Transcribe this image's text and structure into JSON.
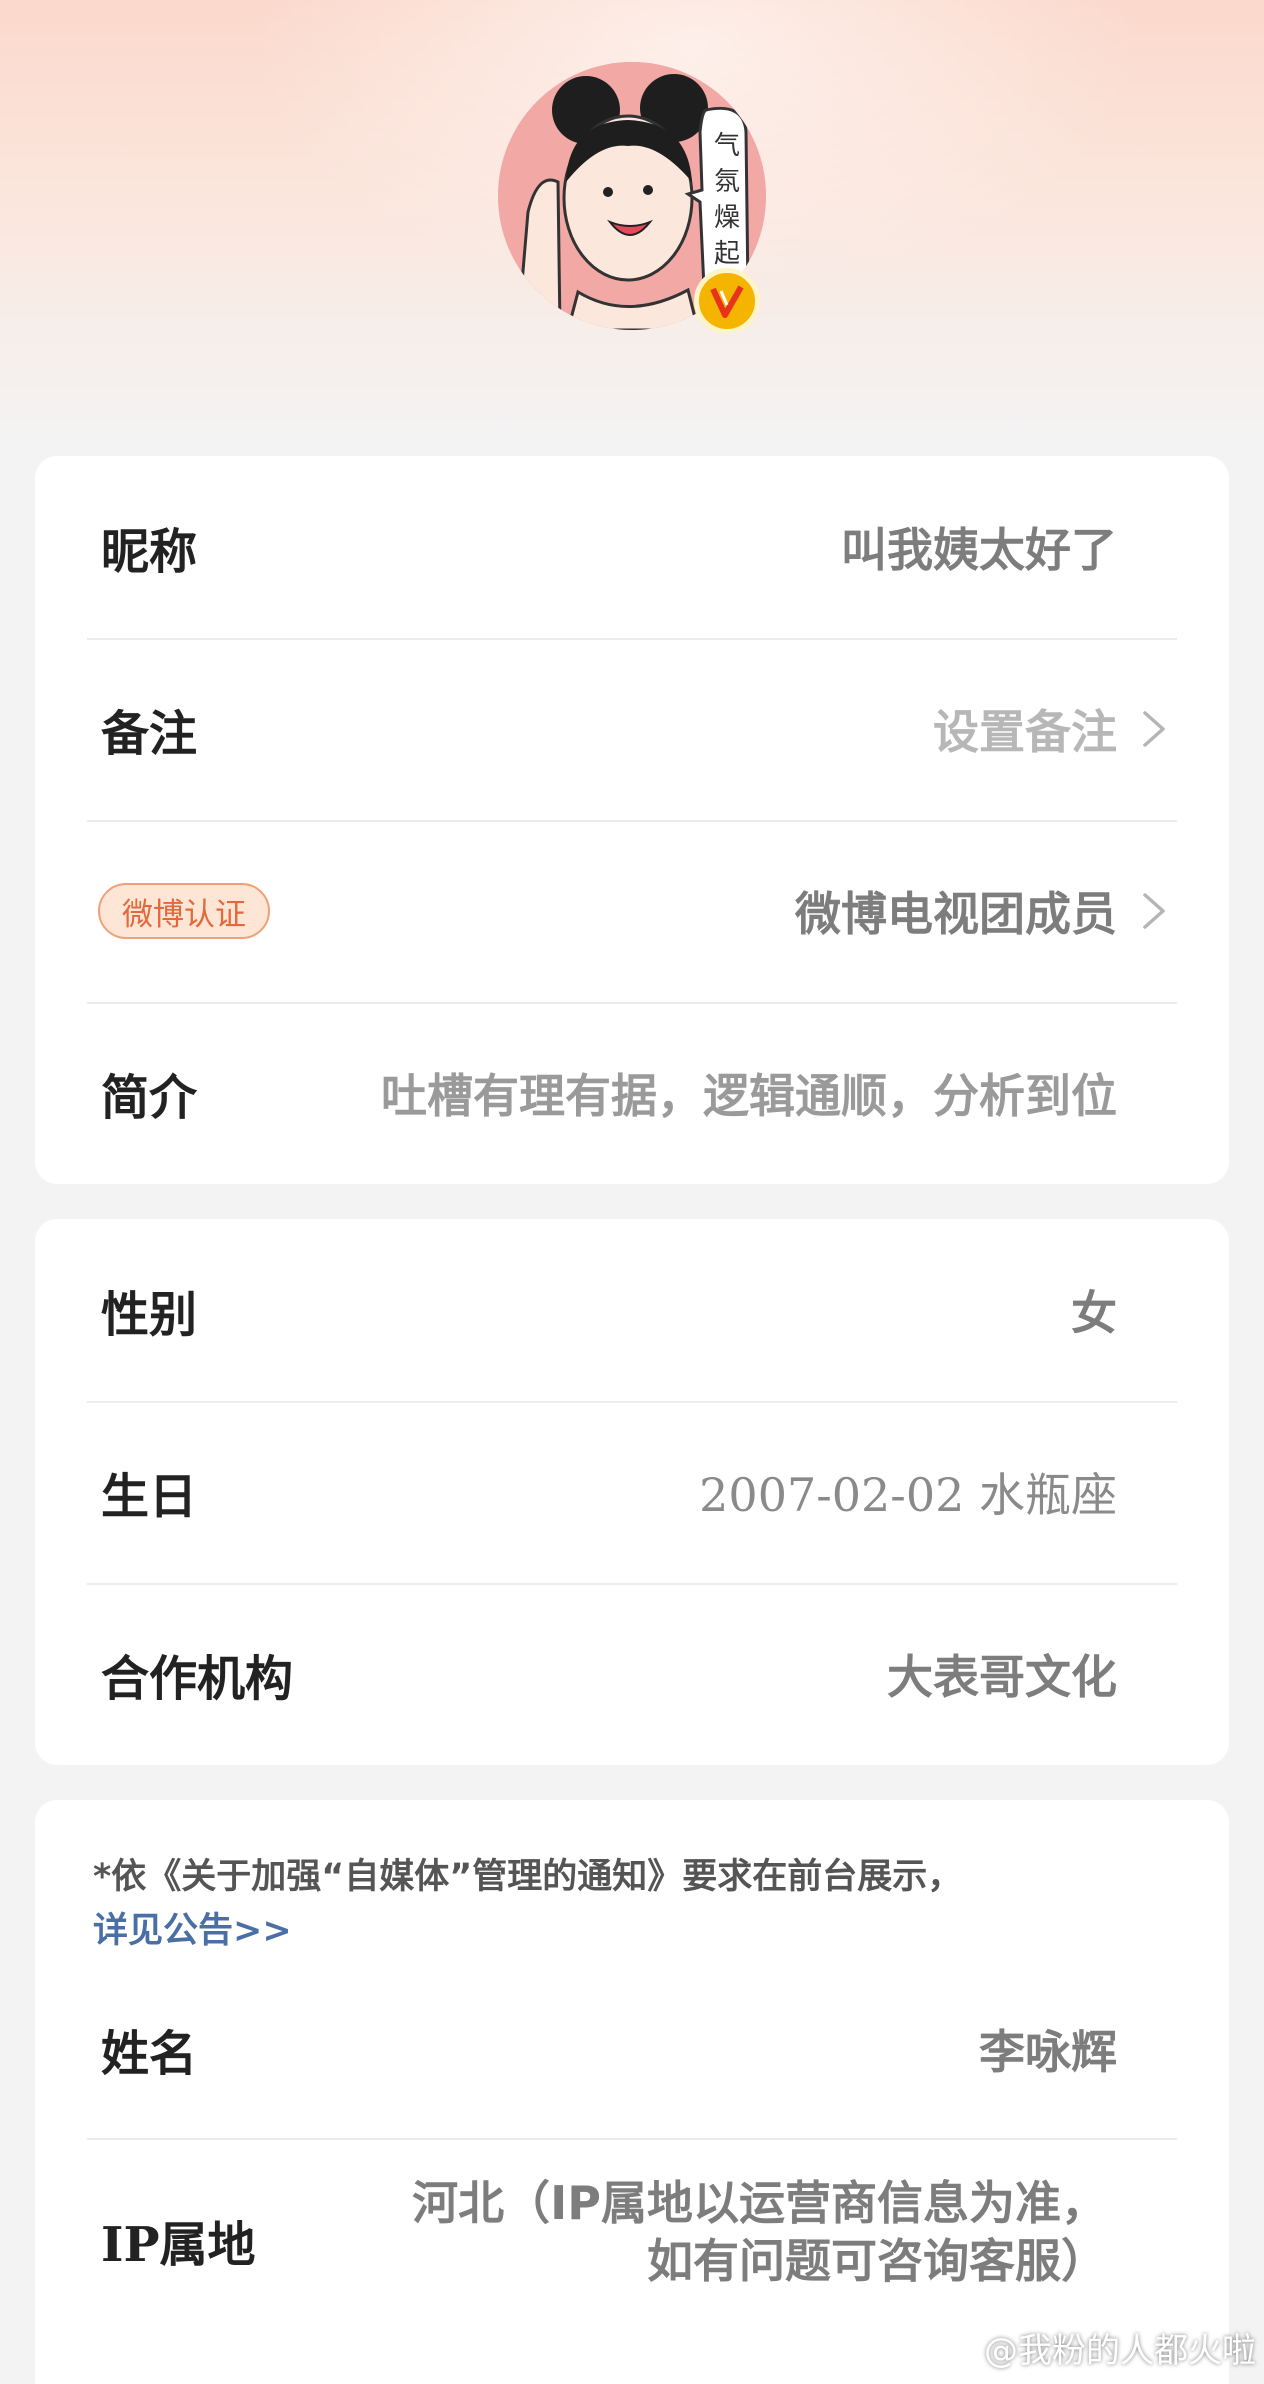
{
  "profile": {
    "nickname_label": "昵称",
    "nickname_value": "叫我姨太好了",
    "remark_label": "备注",
    "remark_value": "设置备注",
    "verify_badge": "微博认证",
    "verify_value": "微博电视团成员",
    "bio_label": "简介",
    "bio_value": "吐槽有理有据，逻辑通顺，分析到位"
  },
  "details": {
    "gender_label": "性别",
    "gender_value": "女",
    "birthday_label": "生日",
    "birthday_value": "2007-02-02 水瓶座",
    "org_label": "合作机构",
    "org_value": "大表哥文化"
  },
  "realname": {
    "notice_text": "*依《关于加强“自媒体”管理的通知》要求在前台展示，",
    "notice_link": "详见公告>>",
    "name_label": "姓名",
    "name_value": "李咏辉",
    "ip_label": "IP属地",
    "ip_value_line1": "河北（IP属地以运营商信息为准，",
    "ip_value_line2": "如有问题可咨询客服）"
  },
  "avatar": {
    "speech_text": "气氛燥起",
    "icon": "verified-v-icon"
  },
  "watermark": {
    "text": "@我粉的人都火啦",
    "icon": "weibo-logo-icon"
  },
  "colors": {
    "badge_text": "#e3683b",
    "badge_bg": "#fde6d6",
    "link": "#4a6fa5",
    "verify_gold": "#f5b400"
  }
}
